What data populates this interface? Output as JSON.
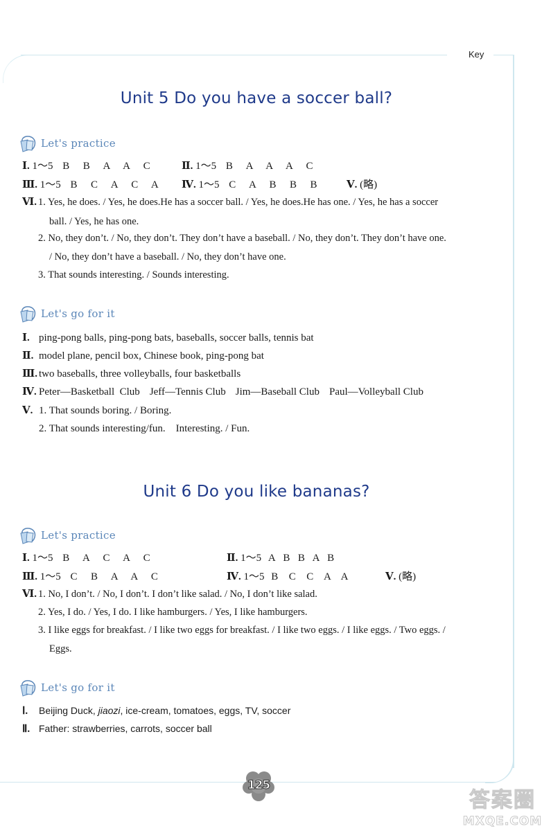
{
  "header": {
    "key_label": "Key"
  },
  "units": [
    {
      "title": "Unit 5  Do you have a soccer ball?",
      "practice": {
        "heading": "Let's practice",
        "row1": [
          {
            "num": "Ⅰ.",
            "range": "1～5",
            "answers": "B  B  A  A  C"
          },
          {
            "num": "Ⅱ.",
            "range": "1～5",
            "answers": "B  A  A  A  C"
          }
        ],
        "row2": [
          {
            "num": "Ⅲ.",
            "range": "1～5",
            "answers": "B  C  A  C  A"
          },
          {
            "num": "Ⅳ.",
            "range": "1～5",
            "answers": "C  A  B  B  B"
          },
          {
            "num": "Ⅴ.",
            "answers": "(略)"
          }
        ],
        "vi": {
          "num": "Ⅵ.",
          "lines": [
            "1. Yes, he does. / Yes, he does.He has a soccer ball. / Yes, he does.He has one. / Yes, he has a soccer",
            "ball. / Yes, he has one.",
            "2. No, they don’t. / No, they don’t. They don’t have a baseball. / No, they don’t. They don’t have one.",
            "/ No, they don’t have a baseball. / No, they don’t have one.",
            "3. That sounds interesting. / Sounds interesting."
          ]
        }
      },
      "go_for_it": {
        "heading": "Let's go for it",
        "items": [
          {
            "num": "Ⅰ.",
            "text": "ping-pong balls, ping-pong bats, baseballs, soccer balls, tennis bat"
          },
          {
            "num": "Ⅱ.",
            "text": "model plane, pencil box, Chinese book, ping-pong bat"
          },
          {
            "num": "Ⅲ.",
            "text": "two baseballs, three volleyballs, four basketballs"
          },
          {
            "num": "Ⅳ.",
            "parts": [
              "Peter—Basketball  Club",
              "Jeff—Tennis Club",
              "Jim—Baseball Club",
              "Paul—Volleyball Club"
            ]
          },
          {
            "num": "Ⅴ.",
            "text": "1. That sounds boring. / Boring."
          },
          {
            "num": "",
            "text": "2. That sounds interesting/fun.    Interesting. / Fun."
          }
        ]
      }
    },
    {
      "title": "Unit 6  Do you like bananas?",
      "practice": {
        "heading": "Let's practice",
        "row1": [
          {
            "num": "Ⅰ.",
            "range": "1～5",
            "answers": "B  A  C  A  C"
          },
          {
            "num": "Ⅱ.",
            "range": "1～5",
            "answers": "A  B  B  A  B"
          }
        ],
        "row2": [
          {
            "num": "Ⅲ.",
            "range": "1～5",
            "answers": "C  B  A  A  C"
          },
          {
            "num": "Ⅳ.",
            "range": "1～5",
            "answers": "B  C  C  A  A"
          },
          {
            "num": "Ⅴ.",
            "answers": "(略)"
          }
        ],
        "vi": {
          "num": "Ⅵ.",
          "lines": [
            "1. No, I don’t. / No, I don’t. I don’t like salad. / No, I don’t like salad.",
            "2. Yes, I do. / Yes, I do. I like hamburgers. / Yes, I like hamburgers.",
            "3. I like eggs for breakfast. / I like two eggs for breakfast. / I like two eggs. / I like eggs. / Two eggs. /",
            "Eggs."
          ]
        }
      },
      "go_for_it": {
        "heading": "Let's go for it",
        "items": [
          {
            "num": "Ⅰ.",
            "pre": "Beijing Duck, ",
            "italic": "jiaozi",
            "post": ", ice-cream, tomatoes, eggs, TV, soccer"
          },
          {
            "num": "Ⅱ.",
            "text": "Father: strawberries, carrots, soccer ball"
          }
        ]
      }
    }
  ],
  "footer": {
    "page_number": "125",
    "watermark_cn": "答案圈",
    "watermark_url": "MXQE.COM"
  }
}
